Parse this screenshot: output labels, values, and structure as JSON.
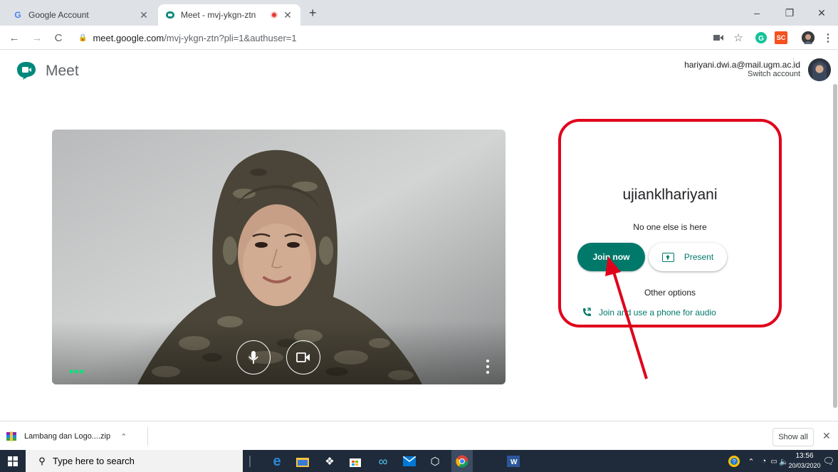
{
  "browser": {
    "tabs": [
      {
        "title": "Google Account",
        "icon": "google-g-icon",
        "active": false
      },
      {
        "title": "Meet - mvj-ykgn-ztn",
        "icon": "meet-icon",
        "active": true,
        "recording": true
      }
    ],
    "new_tab_glyph": "+",
    "window": {
      "minimize": "–",
      "maximize": "❐",
      "close": "✕"
    },
    "url": {
      "host": "meet.google.com",
      "path": "/mvj-ykgn-ztn?pli=1&authuser=1"
    },
    "toolbar_icons": [
      "camera-icon",
      "star-icon",
      "grammarly-icon",
      "extension-sc-icon",
      "profile-icon",
      "menu-icon"
    ],
    "extension_sc_label": "SC"
  },
  "meet": {
    "app_name": "Meet",
    "account_email": "hariyani.dwi.a@mail.ugm.ac.id",
    "switch_account": "Switch account",
    "meeting_name": "ujianklhariyani",
    "status": "No one else is here",
    "join_label": "Join now",
    "present_label": "Present",
    "other_options": "Other options",
    "phone_label": "Join and use a phone for audio",
    "accent_color": "#00796b",
    "highlight_color": "#e0001b"
  },
  "downloads": {
    "file_name": "Lambang dan Logo....zip",
    "show_all": "Show all"
  },
  "taskbar": {
    "search_placeholder": "Type here to search",
    "time": "13:56",
    "date": "20/03/2020",
    "icons": [
      "edge-icon",
      "file-explorer-icon",
      "dropbox-icon",
      "store-icon",
      "infinity-icon",
      "mail-icon",
      "3d-viewer-icon",
      "chrome-icon",
      "word-icon"
    ]
  }
}
